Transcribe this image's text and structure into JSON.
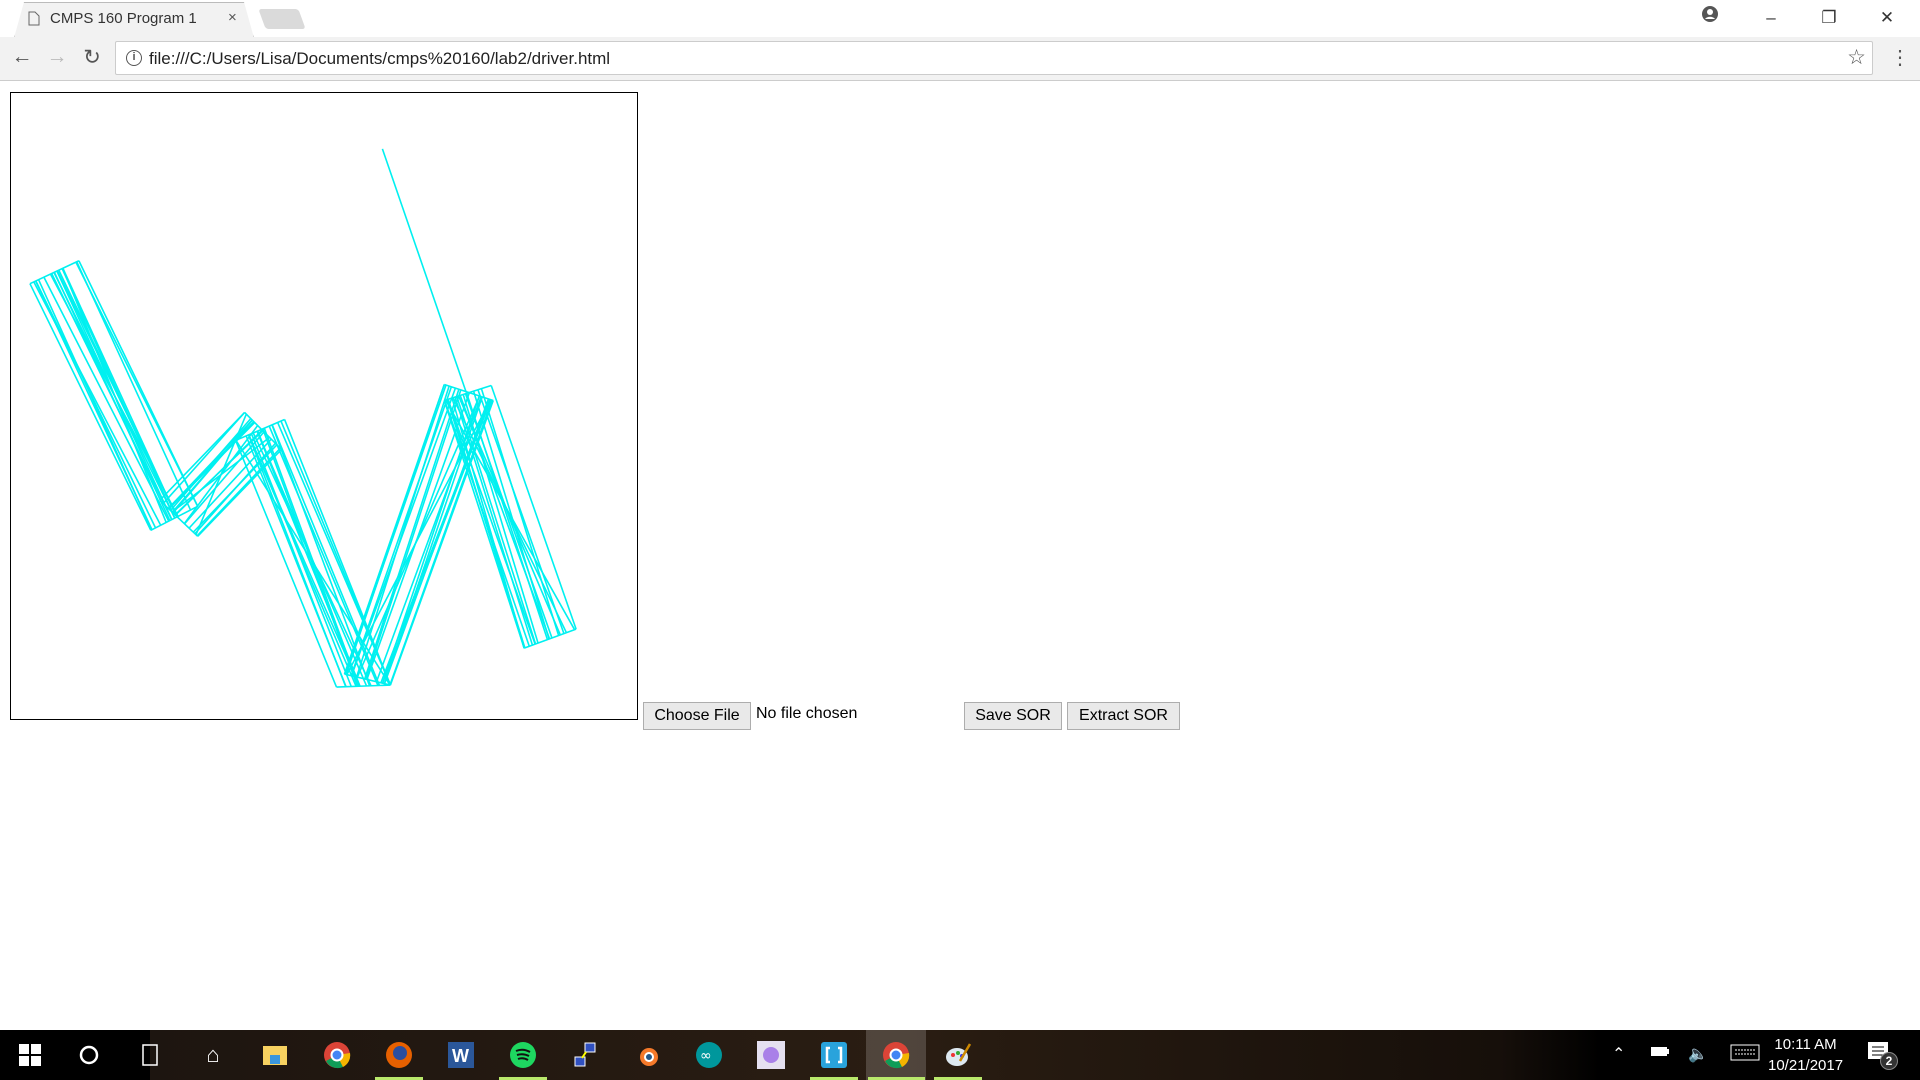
{
  "browser": {
    "tab_title": "CMPS 160 Program 1",
    "tab_close": "×",
    "url": "file:///C:/Users/Lisa/Documents/cmps%20160/lab2/driver.html",
    "icons": [
      "page-icon",
      "close-icon",
      "user-icon",
      "minimize-icon",
      "restore-icon",
      "close-window-icon",
      "back-icon",
      "forward-icon",
      "reload-icon",
      "info-icon",
      "star-icon",
      "menu-icon"
    ]
  },
  "page": {
    "canvas_stroke_color": "#00f0f0",
    "file_input": {
      "button_label": "Choose File",
      "status": "No file chosen"
    },
    "save_label": "Save SOR",
    "extract_label": "Extract SOR"
  },
  "taskbar": {
    "apps": [
      "start",
      "cortana",
      "task-view",
      "home",
      "file-explorer",
      "chrome",
      "firefox",
      "word",
      "spotify",
      "network",
      "blender",
      "arduino",
      "app-purple",
      "brackets",
      "chrome-active",
      "paint"
    ],
    "time": "10:11 AM",
    "date": "10/21/2017",
    "notification_count": "2"
  }
}
